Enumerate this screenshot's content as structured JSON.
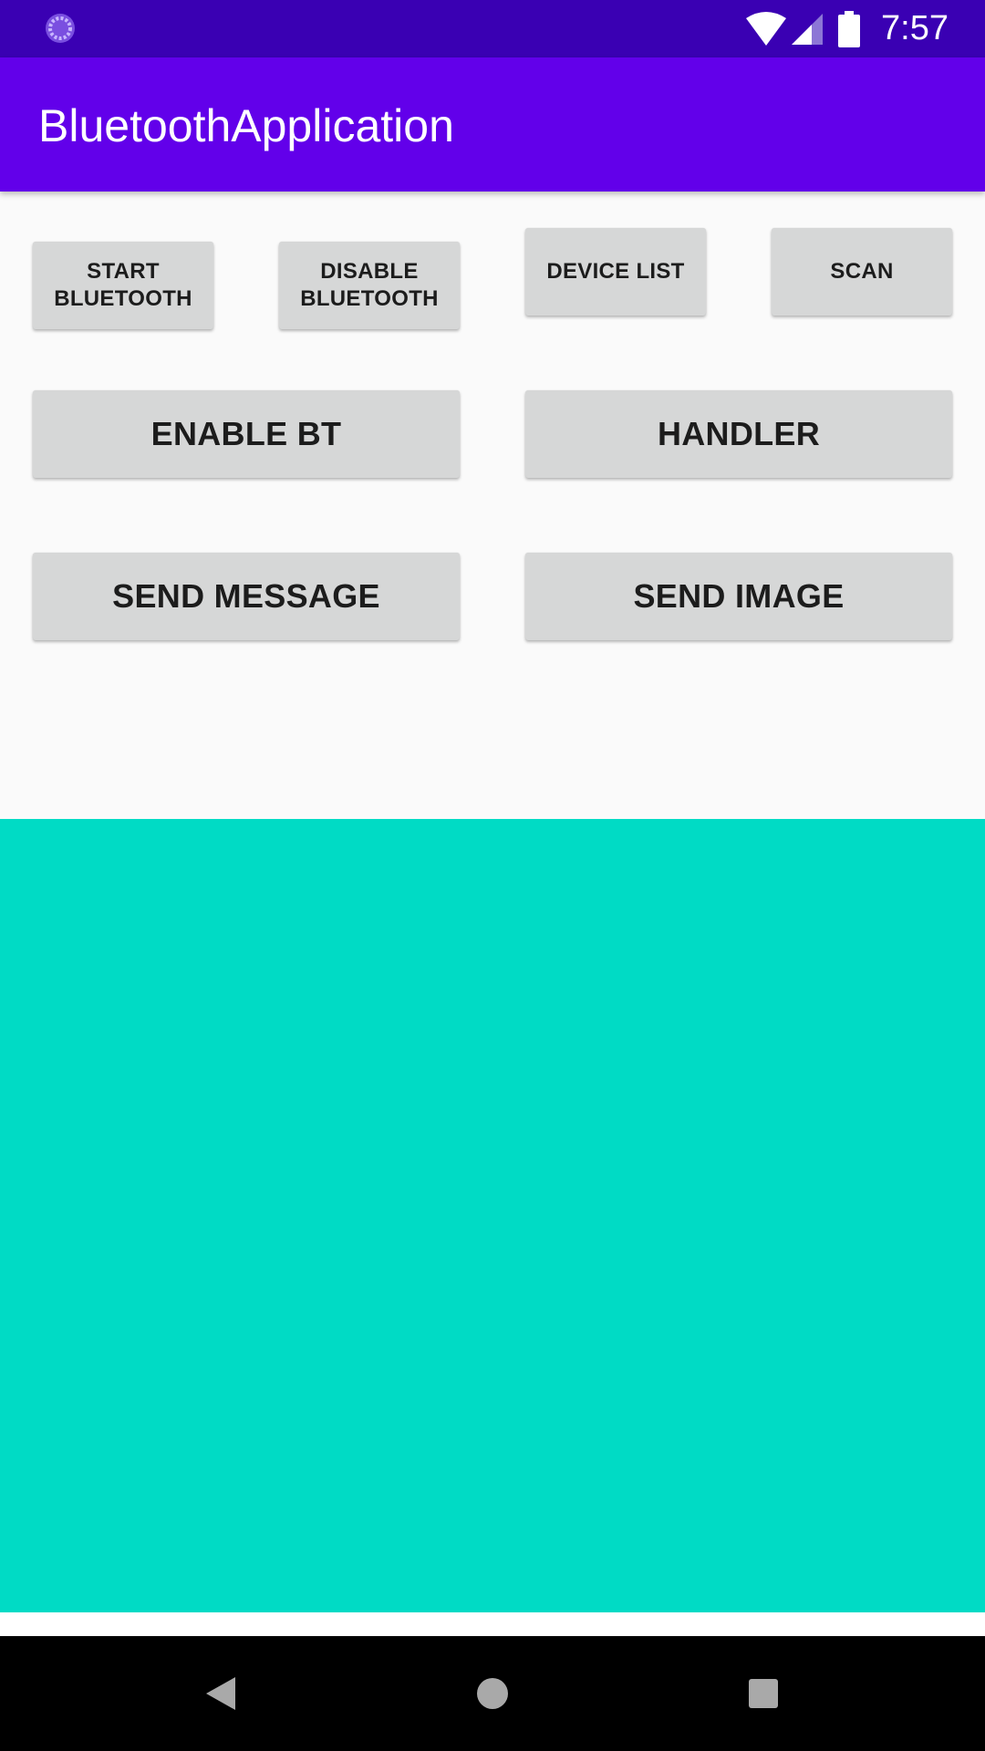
{
  "status_bar": {
    "time": "7:57",
    "icons": [
      "loading-icon",
      "wifi-icon",
      "signal-icon",
      "battery-icon"
    ]
  },
  "app_bar": {
    "title": "BluetoothApplication",
    "color": "#6200ea"
  },
  "buttons": {
    "start_bluetooth": "START\nBLUETOOTH",
    "disable_bluetooth": "DISABLE\nBLUETOOTH",
    "device_list": "DEVICE LIST",
    "scan": "SCAN",
    "enable_bt": "ENABLE BT",
    "handler": "HANDLER",
    "send_message": "SEND MESSAGE",
    "send_image": "SEND IMAGE"
  },
  "content_panel": {
    "color": "#00dbc5"
  },
  "nav_bar": {
    "icons": [
      "back-icon",
      "home-icon",
      "recents-icon"
    ]
  }
}
